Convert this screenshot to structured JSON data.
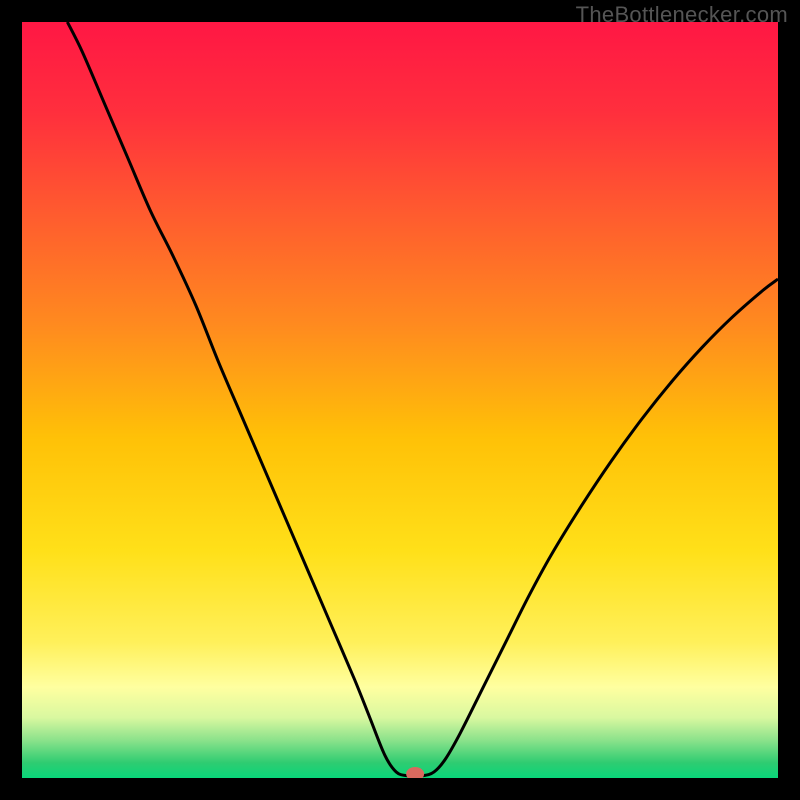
{
  "watermark": "TheBottlenecker.com",
  "chart_data": {
    "type": "line",
    "title": "",
    "xlabel": "",
    "ylabel": "",
    "xlim": [
      0,
      100
    ],
    "ylim": [
      0,
      100
    ],
    "marker": {
      "x": 52,
      "y": 0,
      "color": "#d9695e"
    },
    "background_gradient": {
      "stops": [
        {
          "offset": 0,
          "color": "#ff1744"
        },
        {
          "offset": 12,
          "color": "#ff2f3d"
        },
        {
          "offset": 25,
          "color": "#ff5a2f"
        },
        {
          "offset": 40,
          "color": "#ff8a1f"
        },
        {
          "offset": 55,
          "color": "#ffc107"
        },
        {
          "offset": 70,
          "color": "#ffe019"
        },
        {
          "offset": 82,
          "color": "#fff05a"
        },
        {
          "offset": 88,
          "color": "#ffffa0"
        },
        {
          "offset": 92,
          "color": "#d9f8a0"
        },
        {
          "offset": 95,
          "color": "#8be28b"
        },
        {
          "offset": 98,
          "color": "#2ecc71"
        },
        {
          "offset": 100,
          "color": "#09d67a"
        }
      ]
    },
    "series": [
      {
        "name": "bottleneck-curve",
        "color": "#000000",
        "points": [
          {
            "x": 6,
            "y": 100
          },
          {
            "x": 8,
            "y": 96
          },
          {
            "x": 11,
            "y": 89
          },
          {
            "x": 14,
            "y": 82
          },
          {
            "x": 17,
            "y": 75
          },
          {
            "x": 20,
            "y": 69
          },
          {
            "x": 23,
            "y": 62.5
          },
          {
            "x": 26,
            "y": 55
          },
          {
            "x": 29,
            "y": 48
          },
          {
            "x": 32,
            "y": 41
          },
          {
            "x": 35,
            "y": 34
          },
          {
            "x": 38,
            "y": 27
          },
          {
            "x": 41,
            "y": 20
          },
          {
            "x": 44,
            "y": 13
          },
          {
            "x": 46,
            "y": 8
          },
          {
            "x": 48,
            "y": 3
          },
          {
            "x": 49.5,
            "y": 0.8
          },
          {
            "x": 51,
            "y": 0.3
          },
          {
            "x": 53,
            "y": 0.3
          },
          {
            "x": 54.5,
            "y": 0.8
          },
          {
            "x": 56,
            "y": 2.5
          },
          {
            "x": 58,
            "y": 6
          },
          {
            "x": 61,
            "y": 12
          },
          {
            "x": 64,
            "y": 18
          },
          {
            "x": 67,
            "y": 24
          },
          {
            "x": 70,
            "y": 29.5
          },
          {
            "x": 74,
            "y": 36
          },
          {
            "x": 78,
            "y": 42
          },
          {
            "x": 82,
            "y": 47.5
          },
          {
            "x": 86,
            "y": 52.5
          },
          {
            "x": 90,
            "y": 57
          },
          {
            "x": 94,
            "y": 61
          },
          {
            "x": 98,
            "y": 64.5
          },
          {
            "x": 100,
            "y": 66
          }
        ]
      }
    ]
  }
}
